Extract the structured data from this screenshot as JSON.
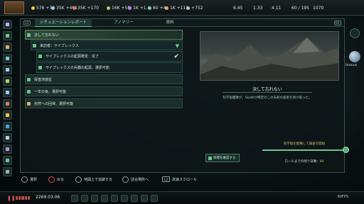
{
  "topbar": {
    "resources": [
      {
        "value": "576 +74",
        "color": "#f2c94c"
      },
      {
        "value": "35K +401",
        "color": "#9ad0ff"
      },
      {
        "value": "35K +170",
        "color": "#e07a5f"
      },
      {
        "value": "16K +56",
        "color": "#b6d36a"
      },
      {
        "value": "1K +1.4",
        "color": "#c08ae8"
      },
      {
        "value": "60 +4",
        "color": "#7ad0c0"
      },
      {
        "value": "1K +111",
        "color": "#e0b070"
      },
      {
        "value": "+752",
        "color": "#c0c0c0"
      },
      {
        "value": "6.45",
        "color": "#9cb8a6"
      },
      {
        "value": "1.33",
        "color": "#9cb8a6"
      },
      {
        "value": "4.11",
        "color": "#9cb8a6"
      },
      {
        "value": "60 / 195",
        "color": "#9cb8a6"
      },
      {
        "value": "1070",
        "color": "#9cb8a6"
      }
    ]
  },
  "tabs": [
    {
      "key": "L1",
      "label": ""
    },
    {
      "key": "",
      "label": "シチュエーションレポート"
    },
    {
      "key": "",
      "label": "アノマリー"
    },
    {
      "key": "",
      "label": "資料"
    },
    {
      "key": "R1",
      "label": ""
    }
  ],
  "list": {
    "items": [
      {
        "label": "決して忘れない",
        "kind": "header",
        "icon": "flag-icon",
        "state": "expanded"
      },
      {
        "label": "来訪者：サイブレックス",
        "kind": "sub",
        "icon": "situation-icon",
        "state": "expanded"
      },
      {
        "label": "サイブレックスの起源発見：完了",
        "kind": "sub2",
        "icon": "research-icon",
        "state": "complete"
      },
      {
        "label": "サイブレックスの兵器の起源、選択可能",
        "kind": "sub2",
        "icon": "research-icon",
        "state": ""
      },
      {
        "label": "探査済惑星",
        "kind": "item",
        "icon": "planet-icon",
        "state": ""
      },
      {
        "label": "一年の後、選択可能",
        "kind": "item",
        "icon": "clock-icon",
        "state": ""
      },
      {
        "label": "自然への回帰、選択可能",
        "kind": "item",
        "icon": "warning-icon",
        "state": ""
      }
    ]
  },
  "detail": {
    "title": "決して忘れない",
    "description": "科学船艦隊が、SkaWが特定のこの未知の惑星を受け取った。",
    "target_button": "目標を確認する",
    "progress_label": "科学船を配備して調査を開始",
    "progress_fraction": 0.98,
    "days_label": "ロールまでの残り日数：",
    "days_value": "90"
  },
  "bottom_hints": [
    {
      "icon": "cross-button-icon",
      "label": "選択"
    },
    {
      "icon": "circle-button-icon",
      "label": "戻る"
    },
    {
      "icon": "square-button-icon",
      "label": "地図上で追跡する"
    },
    {
      "icon": "triangle-button-icon",
      "label": "話合場所へ"
    },
    {
      "icon": "l2-button-icon",
      "key": "L2",
      "label": "高速スクロール"
    }
  ],
  "statusbar": {
    "date": "2269.03.06",
    "fps": "60FPS"
  },
  "planet_label": "Uranus"
}
